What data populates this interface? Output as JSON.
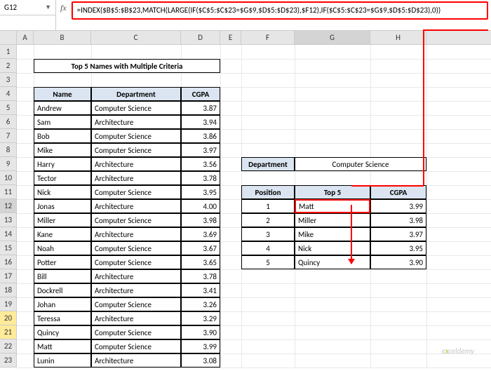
{
  "nameBox": "G12",
  "fxLabel": "fx",
  "formula": "=INDEX($B$5:$B$23,MATCH(LARGE(IF($C$5:$C$23=$G$9,$D$5:$D$23),$F12),IF($C$5:$C$23=$G$9,$D$5:$D$23),0))",
  "cols": [
    "A",
    "B",
    "C",
    "D",
    "E",
    "F",
    "G",
    "H"
  ],
  "colW": {
    "A": 24,
    "B": 82,
    "C": 128,
    "D": 56,
    "E": 30,
    "F": 76,
    "G": 108,
    "H": 80
  },
  "rows": 23,
  "title": "Top 5 Names with Multiple Criteria",
  "headers": {
    "name": "Name",
    "dept": "Department",
    "cgpa": "CGPA"
  },
  "data": [
    {
      "name": "Andrew",
      "dept": "Computer Science",
      "cgpa": "3.87"
    },
    {
      "name": "Sam",
      "dept": "Architecture",
      "cgpa": "3.94"
    },
    {
      "name": "Bob",
      "dept": "Computer Science",
      "cgpa": "3.86"
    },
    {
      "name": "Mike",
      "dept": "Computer Science",
      "cgpa": "3.97"
    },
    {
      "name": "Harry",
      "dept": "Architecture",
      "cgpa": "3.56"
    },
    {
      "name": "Tector",
      "dept": "Architecture",
      "cgpa": "3.78"
    },
    {
      "name": "Nick",
      "dept": "Computer Science",
      "cgpa": "3.95"
    },
    {
      "name": "Jonas",
      "dept": "Architecture",
      "cgpa": "4.00"
    },
    {
      "name": "Miller",
      "dept": "Computer Science",
      "cgpa": "3.98"
    },
    {
      "name": "Kane",
      "dept": "Architecture",
      "cgpa": "3.69"
    },
    {
      "name": "Noah",
      "dept": "Computer Science",
      "cgpa": "3.67"
    },
    {
      "name": "Potter",
      "dept": "Computer Science",
      "cgpa": "3.65"
    },
    {
      "name": "Bill",
      "dept": "Architecture",
      "cgpa": "3.78"
    },
    {
      "name": "Dockrell",
      "dept": "Architecture",
      "cgpa": "3.41"
    },
    {
      "name": "Johan",
      "dept": "Computer Science",
      "cgpa": "3.26"
    },
    {
      "name": "Teressa",
      "dept": "Architecture",
      "cgpa": "3.29"
    },
    {
      "name": "Quincy",
      "dept": "Computer Science",
      "cgpa": "3.90"
    },
    {
      "name": "Matt",
      "dept": "Computer Science",
      "cgpa": "3.99"
    },
    {
      "name": "Lunin",
      "dept": "Architecture",
      "cgpa": "3.08"
    }
  ],
  "side": {
    "deptLabel": "Department",
    "deptValue": "Computer Science",
    "posLabel": "Position",
    "topLabel": "Top 5",
    "cgpaLabel": "CGPA",
    "rows": [
      {
        "pos": "1",
        "name": "Matt",
        "cgpa": "3.99"
      },
      {
        "pos": "2",
        "name": "Miller",
        "cgpa": "3.98"
      },
      {
        "pos": "3",
        "name": "Mike",
        "cgpa": "3.97"
      },
      {
        "pos": "4",
        "name": "Nick",
        "cgpa": "3.95"
      },
      {
        "pos": "5",
        "name": "Quincy",
        "cgpa": "3.90"
      }
    ]
  },
  "watermark": {
    "pre": "e",
    "x": "x",
    "post": "celdemy"
  }
}
